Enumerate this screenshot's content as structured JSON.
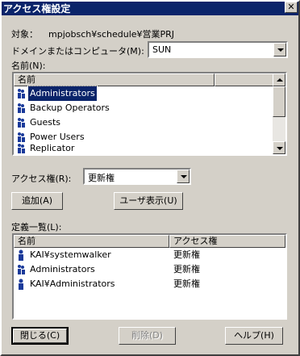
{
  "window": {
    "title": "アクセス権設定"
  },
  "target": {
    "label": "対象：",
    "value": "mpjobsch¥schedule¥営業PRJ"
  },
  "domain_select": {
    "label": "ドメインまたはコンピュータ(M):",
    "value": "SUN"
  },
  "names_list": {
    "label": "名前(N):",
    "header": "名前",
    "items": [
      {
        "label": "Administrators",
        "selected": true
      },
      {
        "label": "Backup Operators"
      },
      {
        "label": "Guests"
      },
      {
        "label": "Power Users"
      },
      {
        "label": "Replicator"
      }
    ]
  },
  "access_select": {
    "label": "アクセス権(R):",
    "value": "更新権"
  },
  "buttons": {
    "add": "追加(A)",
    "show_users": "ユーザ表示(U)",
    "close": "閉じる(C)",
    "delete": "削除(D)",
    "help": "ヘルプ(H)"
  },
  "definitions": {
    "label": "定義一覧(L):",
    "columns": [
      "名前",
      "アクセス権"
    ],
    "rows": [
      {
        "name": "KAI¥systemwalker",
        "access": "更新権",
        "icon": "user-icon"
      },
      {
        "name": "Administrators",
        "access": "更新権",
        "icon": "group-icon"
      },
      {
        "name": "KAI¥Administrators",
        "access": "更新権",
        "icon": "user-icon"
      }
    ]
  },
  "colors": {
    "titlebar": "#0a246a",
    "face": "#d4d0c8",
    "selection": "#0a246a"
  }
}
